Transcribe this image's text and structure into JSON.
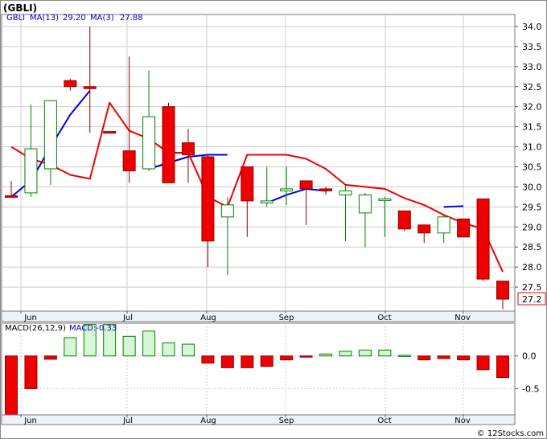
{
  "title": "(GBLI)",
  "price_legend": {
    "ticker": "GBLI",
    "ma13_label": "MA(13)",
    "ma13_value": "29.20",
    "ma3_label": "MA(3)",
    "ma3_value": "27.88"
  },
  "macd_legend": {
    "label": "MACD(26,12,9)",
    "value_label": "MACD:-0.33"
  },
  "current_price_tag": "27.2",
  "watermark": "© 12Stocks.com",
  "colors": {
    "up_candle_fill": "#ffffff",
    "up_candle_stroke": "#008000",
    "down_candle_fill": "#ee0000",
    "ma13_line": "#0000dd",
    "ma3_line": "#ee0000",
    "macd_positive_fill": "#d8f5d8",
    "macd_positive_stroke": "#008000",
    "macd_negative_fill": "#ee0000",
    "grid": "#cccccc"
  },
  "chart_data": [
    {
      "type": "candlestick",
      "ticker": "GBLI",
      "x_tick_labels": [
        "Jun",
        "Jul",
        "Aug",
        "Sep",
        "Oct",
        "Nov"
      ],
      "y_tick_labels": [
        "27.5",
        "28.0",
        "28.5",
        "29.0",
        "29.5",
        "30.0",
        "30.5",
        "31.0",
        "31.5",
        "32.0",
        "32.5",
        "33.0",
        "33.5",
        "34.0"
      ],
      "ylim": [
        26.9,
        34.3
      ],
      "grid": true,
      "candles": [
        {
          "open": 29.78,
          "high": 30.15,
          "low": 29.75,
          "close": 29.75
        },
        {
          "open": 29.85,
          "high": 32.05,
          "low": 29.75,
          "close": 30.95
        },
        {
          "open": 30.45,
          "high": 32.15,
          "low": 30.05,
          "close": 32.15
        },
        {
          "open": 32.65,
          "high": 32.7,
          "low": 32.4,
          "close": 32.5
        },
        {
          "open": 32.5,
          "high": 34.0,
          "low": 31.35,
          "close": 32.45
        },
        {
          "open": 31.38,
          "high": 31.38,
          "low": 31.35,
          "close": 31.35
        },
        {
          "open": 30.9,
          "high": 33.25,
          "low": 30.1,
          "close": 30.4
        },
        {
          "open": 30.45,
          "high": 32.9,
          "low": 30.4,
          "close": 31.75
        },
        {
          "open": 32.0,
          "high": 32.1,
          "low": 30.1,
          "close": 30.1
        },
        {
          "open": 31.1,
          "high": 31.45,
          "low": 30.1,
          "close": 30.8
        },
        {
          "open": 30.75,
          "high": 30.8,
          "low": 28.0,
          "close": 28.65
        },
        {
          "open": 29.25,
          "high": 29.75,
          "low": 27.8,
          "close": 29.55
        },
        {
          "open": 30.5,
          "high": 30.5,
          "low": 28.75,
          "close": 29.65
        },
        {
          "open": 29.6,
          "high": 30.5,
          "low": 29.5,
          "close": 29.65
        },
        {
          "open": 29.9,
          "high": 30.5,
          "low": 29.55,
          "close": 29.95
        },
        {
          "open": 30.15,
          "high": 30.15,
          "low": 29.05,
          "close": 29.95
        },
        {
          "open": 29.95,
          "high": 30.0,
          "low": 29.8,
          "close": 29.9
        },
        {
          "open": 29.8,
          "high": 30.05,
          "low": 28.65,
          "close": 29.9
        },
        {
          "open": 29.35,
          "high": 29.85,
          "low": 28.5,
          "close": 29.8
        },
        {
          "open": 29.7,
          "high": 29.75,
          "low": 28.75,
          "close": 29.7
        },
        {
          "open": 29.4,
          "high": 29.4,
          "low": 28.9,
          "close": 28.95
        },
        {
          "open": 29.05,
          "high": 29.05,
          "low": 28.6,
          "close": 28.85
        },
        {
          "open": 28.85,
          "high": 29.3,
          "low": 28.6,
          "close": 29.25
        },
        {
          "open": 29.2,
          "high": 29.2,
          "low": 28.75,
          "close": 28.75
        },
        {
          "open": 29.7,
          "high": 29.7,
          "low": 27.65,
          "close": 27.7
        },
        {
          "open": 27.65,
          "high": 27.65,
          "low": 26.95,
          "close": 27.2
        }
      ],
      "series": [
        {
          "name": "MA(13)",
          "values": [
            29.75,
            30.15,
            31.0,
            31.8,
            32.4,
            null,
            null,
            30.45,
            30.6,
            30.75,
            30.8,
            30.8,
            null,
            29.6,
            29.8,
            29.95,
            29.9,
            null,
            null,
            null,
            null,
            null,
            29.5,
            29.52,
            null,
            null
          ]
        },
        {
          "name": "MA(3)",
          "values": [
            31.0,
            30.7,
            30.55,
            30.3,
            30.2,
            32.1,
            31.4,
            31.2,
            30.85,
            30.85,
            29.75,
            29.5,
            30.8,
            30.8,
            30.8,
            30.7,
            30.45,
            30.05,
            30.0,
            29.95,
            29.72,
            29.55,
            29.3,
            29.1,
            28.95,
            27.88
          ]
        }
      ]
    },
    {
      "type": "bar",
      "name": "MACD(26,12,9)",
      "y_tick_labels": [
        "0.0",
        "-0.5"
      ],
      "ylim": [
        -0.9,
        0.5
      ],
      "grid": true,
      "values": [
        -0.9,
        -0.5,
        -0.05,
        0.28,
        0.48,
        0.48,
        0.3,
        0.38,
        0.2,
        0.18,
        -0.11,
        -0.18,
        -0.18,
        -0.16,
        -0.06,
        -0.01,
        0.03,
        0.07,
        0.09,
        0.09,
        0.01,
        -0.06,
        -0.04,
        -0.06,
        -0.21,
        -0.33
      ]
    }
  ]
}
